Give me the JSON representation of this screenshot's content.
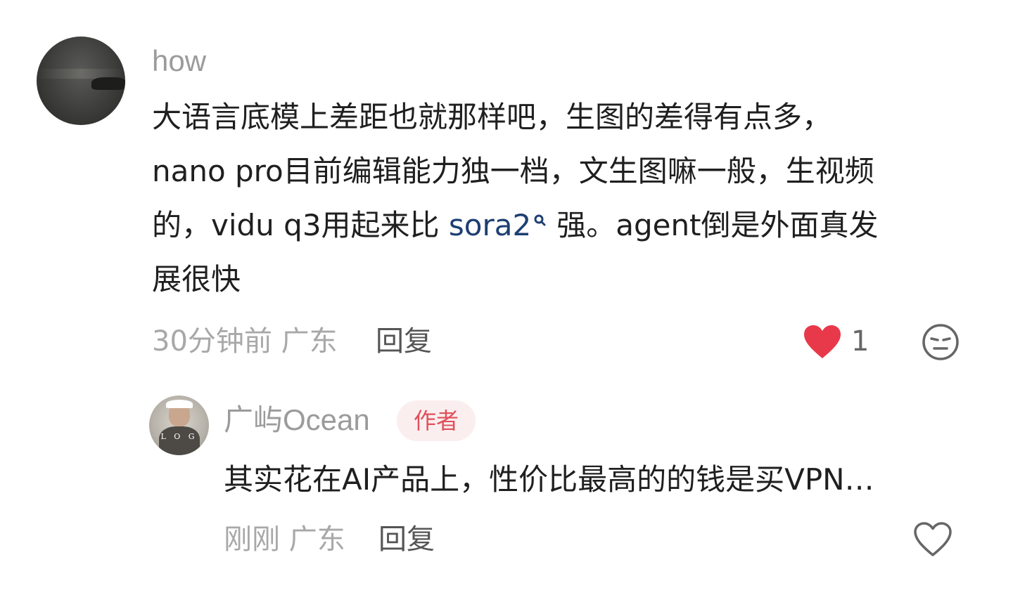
{
  "comment": {
    "username": "how",
    "text_lines": [
      "大语言底模上差距也就那样吧，生图的差得有点多，",
      "nano pro目前编辑能力独一档，文生图嘛一般，生视频"
    ],
    "line3_before": "的，vidu q3用起来比 ",
    "line3_link": "sora2",
    "line3_after": "强。agent倒是外面真发",
    "line4": "展很快",
    "time": "30分钟前",
    "location": "广东",
    "reply_label": "回复",
    "like_count": "1",
    "liked": true
  },
  "reply": {
    "username": "广屿Ocean",
    "badge": "作者",
    "text": "其实花在AI产品上，性价比最高的的钱是买VPN…",
    "time": "刚刚",
    "location": "广东",
    "reply_label": "回复",
    "liked": false
  },
  "icons": {
    "search": "search-icon",
    "heart_filled": "heart-filled-icon",
    "heart_outline": "heart-outline-icon",
    "emoji": "emoji-icon"
  },
  "colors": {
    "heart_red": "#e8394a",
    "link": "#1d3f72",
    "badge_text": "#e0505a",
    "badge_bg": "#fbeeef"
  }
}
